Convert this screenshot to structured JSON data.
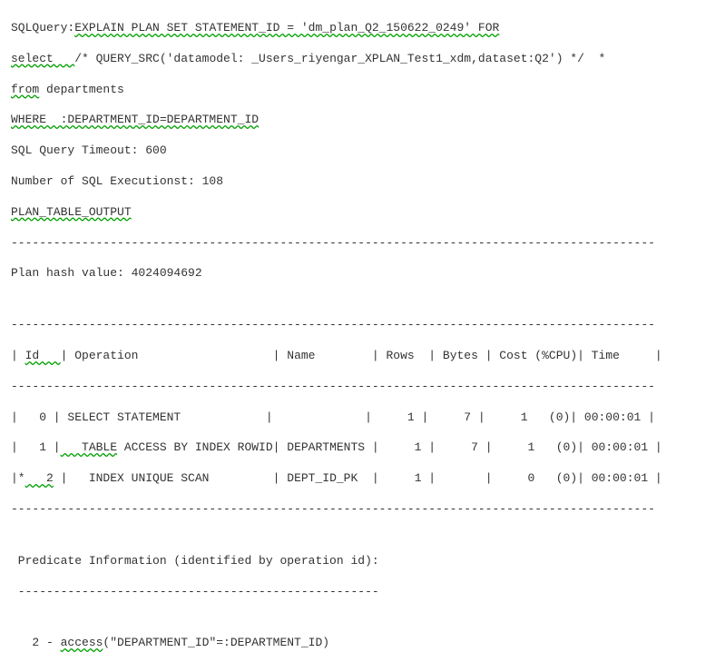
{
  "l1a": "SQLQuery:",
  "l1b": "EXPLAIN PLAN SET STATEMENT_ID = 'dm_plan_Q2_150622_0249' FOR",
  "l2a": "select   ",
  "l2b": "/* QUERY_SRC('datamodel: _Users_riyengar_XPLAN_Test1_xdm,dataset:Q2') */  *",
  "l3a": "from",
  "l3b": " departments",
  "l4a": "WHERE  :DEPARTMENT_ID=DEPARTMENT_ID",
  "l5": "SQL Query Timeout: 600",
  "l6": "Number of SQL Executionst: 108",
  "l7": "PLAN_TABLE_OUTPUT",
  "l8": "-------------------------------------------------------------------------------------------",
  "l9": "Plan hash value: 4024094692",
  "l10": "-------------------------------------------------------------------------------------------",
  "l11a": "| ",
  "l11b": "Id   ",
  "l11c": "| Operation                   | Name        | Rows  | Bytes | Cost (%CPU)| Time     |",
  "l12": "-------------------------------------------------------------------------------------------",
  "r1": "|   0 | SELECT STATEMENT            |             |     1 |     7 |     1   (0)| 00:00:01 |",
  "r2a": "|   1 |",
  "r2b": "   TABLE",
  "r2c": " ACCESS BY INDEX ROWID| DEPARTMENTS |     1 |     7 |     1   (0)| 00:00:01 |",
  "r3a": "|*",
  "r3b": "   2",
  "r3c": " |   INDEX UNIQUE SCAN         | DEPT_ID_PK  |     1 |       |     0   (0)| 00:00:01 |",
  "l13": "-------------------------------------------------------------------------------------------",
  "l14": " Predicate Information (identified by operation id):",
  "l15": " ---------------------------------------------------",
  "l16a": "   2 - ",
  "l16b": "access",
  "l16c": "(\"DEPARTMENT_ID\"=:DEPARTMENT_ID)"
}
